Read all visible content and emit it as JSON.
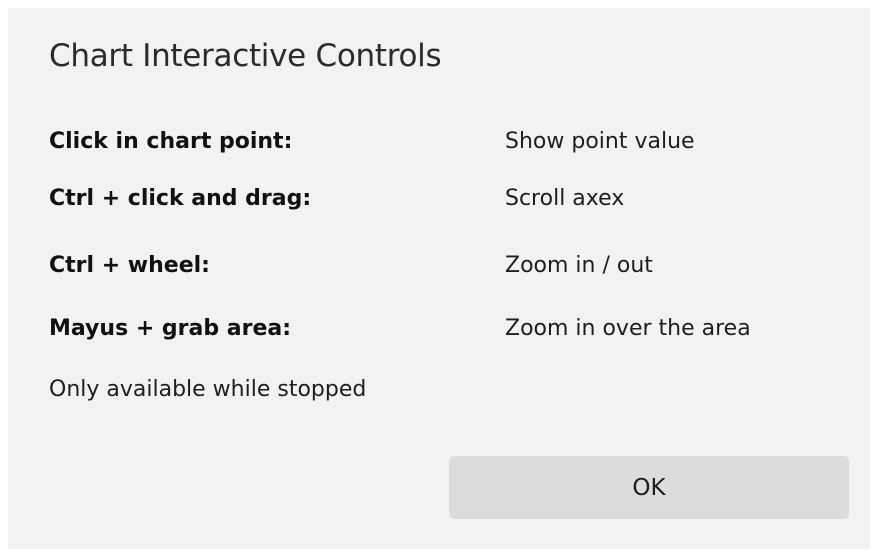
{
  "dialog": {
    "title": "Chart Interactive Controls",
    "controls": [
      {
        "key": "Click in chart point:",
        "value": "Show point value"
      },
      {
        "key": "Ctrl + click and drag:",
        "value": "Scroll axex"
      },
      {
        "key": "Ctrl + wheel:",
        "value": "Zoom in / out"
      },
      {
        "key": "Mayus + grab area:",
        "value": "Zoom in over the area"
      }
    ],
    "note": "Only available while stopped",
    "ok_label": "OK"
  }
}
